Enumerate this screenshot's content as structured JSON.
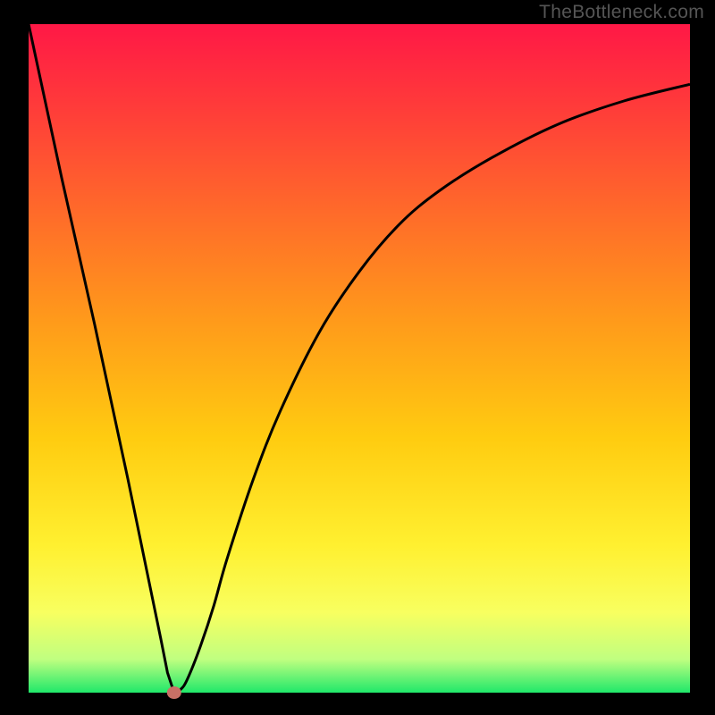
{
  "watermark": "TheBottleneck.com",
  "chart_data": {
    "type": "line",
    "title": "",
    "xlabel": "",
    "ylabel": "",
    "xlim": [
      0,
      100
    ],
    "ylim": [
      0,
      100
    ],
    "background_gradient": {
      "stops": [
        {
          "offset": 0.0,
          "color": "#ff1846"
        },
        {
          "offset": 0.12,
          "color": "#ff3a3a"
        },
        {
          "offset": 0.28,
          "color": "#ff6a2a"
        },
        {
          "offset": 0.45,
          "color": "#ff9c1a"
        },
        {
          "offset": 0.62,
          "color": "#ffcc10"
        },
        {
          "offset": 0.78,
          "color": "#fff030"
        },
        {
          "offset": 0.88,
          "color": "#f8ff60"
        },
        {
          "offset": 0.95,
          "color": "#c0ff80"
        },
        {
          "offset": 1.0,
          "color": "#20e86a"
        }
      ]
    },
    "curve": {
      "description": "V-shaped bottleneck curve; minimum near x≈22",
      "x": [
        0,
        5,
        10,
        15,
        20,
        21,
        22,
        23,
        24,
        26,
        28,
        30,
        34,
        38,
        44,
        50,
        56,
        62,
        70,
        80,
        90,
        100
      ],
      "y": [
        100,
        77,
        55,
        32,
        8,
        3,
        0,
        0.5,
        2,
        7,
        13,
        20,
        32,
        42,
        54,
        63,
        70,
        75,
        80,
        85,
        88.5,
        91
      ]
    },
    "marker": {
      "x": 22,
      "y": 0,
      "color": "#c87066",
      "radius": 7
    }
  }
}
